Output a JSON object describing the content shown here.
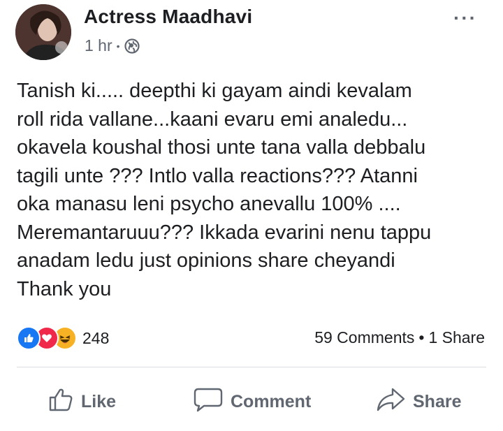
{
  "post": {
    "author": "Actress Maadhavi",
    "time": "1 hr",
    "separator": "•",
    "privacy_icon": "globe-icon",
    "more_icon": "more-options-icon",
    "lines": [
      "Tanish ki..... deepthi ki gayam aindi kevalam",
      "roll rida vallane...kaani evaru emi analedu...",
      "okavela koushal thosi unte tana valla debbalu",
      "tagili unte ??? Intlo valla reactions??? Atanni",
      "oka manasu leni psycho anevallu 100% ....",
      "Meremantaruuu??? Ikkada evarini nenu tappu",
      "anadam ledu just opinions share cheyandi",
      "Thank you"
    ]
  },
  "reactions": {
    "icons": [
      "like-reaction-icon",
      "love-reaction-icon",
      "haha-reaction-icon"
    ],
    "count": "248"
  },
  "stats": {
    "comments": "59 Comments",
    "separator": "•",
    "shares": "1 Share"
  },
  "actions": {
    "like": "Like",
    "comment": "Comment",
    "share": "Share"
  },
  "colors": {
    "like_blue": "#1877f2",
    "love_red": "#f02849",
    "haha_yellow": "#f7b125",
    "muted": "#606770",
    "text": "#1c1e21"
  }
}
